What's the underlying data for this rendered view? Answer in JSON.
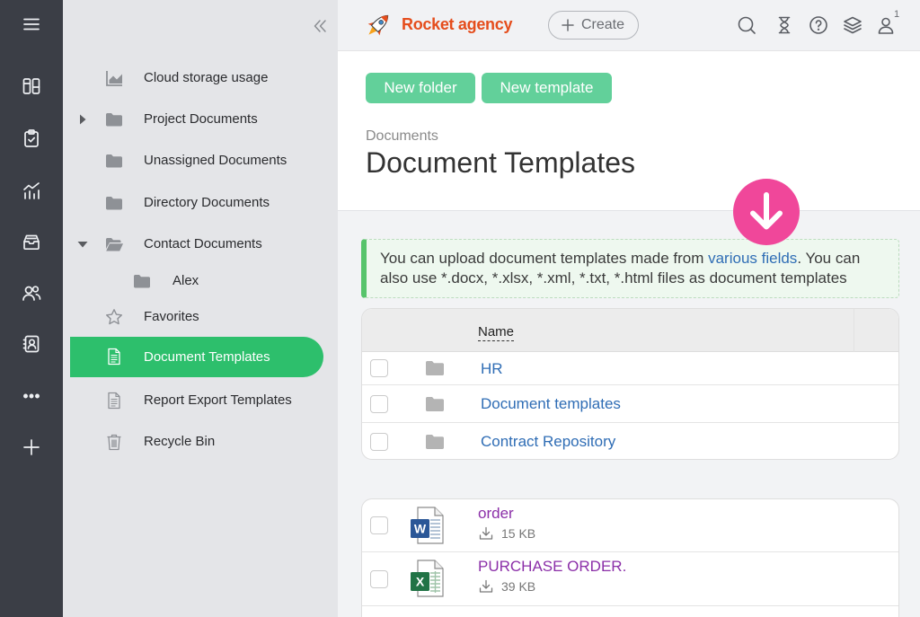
{
  "rail": {
    "items": [
      "menu-icon",
      "boards-icon",
      "tasks-icon",
      "analytics-icon",
      "inbox-icon",
      "team-icon",
      "address-book-icon",
      "more-icon",
      "add-icon"
    ]
  },
  "sidebar": {
    "collapse_icon": "double-chevron-left-icon",
    "items": [
      {
        "label": "Cloud storage usage",
        "icon": "area-chart-icon"
      },
      {
        "label": "Project Documents",
        "icon": "folder-icon",
        "expanded": false
      },
      {
        "label": "Unassigned Documents",
        "icon": "folder-icon"
      },
      {
        "label": "Directory Documents",
        "icon": "folder-icon"
      },
      {
        "label": "Contact Documents",
        "icon": "folder-open-icon",
        "expanded": true,
        "children": [
          {
            "label": "Alex",
            "icon": "folder-icon"
          }
        ]
      },
      {
        "label": "Favorites",
        "icon": "star-icon"
      },
      {
        "label": "Document Templates",
        "icon": "document-icon",
        "active": true
      },
      {
        "label": "Report Export Templates",
        "icon": "document-icon"
      },
      {
        "label": "Recycle Bin",
        "icon": "trash-icon"
      }
    ]
  },
  "header": {
    "brand": "Rocket agency",
    "create_label": "Create",
    "icons": [
      "search-icon",
      "hourglass-icon",
      "help-icon",
      "layers-icon",
      "user-icon"
    ],
    "user_badge": "1"
  },
  "toolbar": {
    "new_folder": "New folder",
    "new_template": "New template"
  },
  "breadcrumb": "Documents",
  "title": "Document Templates",
  "info": {
    "text_before": "You can upload document templates made from ",
    "link": "various fields",
    "text_after": ". You can also use *.docx, *.xlsx, *.xml, *.txt, *.html files as document templates"
  },
  "folders_table": {
    "column_name": "Name",
    "rows": [
      {
        "name": "HR"
      },
      {
        "name": "Document templates"
      },
      {
        "name": "Contract Repository"
      }
    ]
  },
  "files": [
    {
      "name": "order",
      "size": "15 KB",
      "icon": "word-file-icon",
      "badge": "W"
    },
    {
      "name": "PURCHASE ORDER.",
      "size": "39 KB",
      "icon": "excel-file-icon",
      "badge": "X"
    }
  ],
  "colors": {
    "accent": "#2dbf6c",
    "brand": "#e54d1c",
    "link": "#2f6db5",
    "visited_link": "#8b2fa8",
    "button": "#62d09a",
    "marker": "#f0479a",
    "info_bar": "#57c46b"
  }
}
